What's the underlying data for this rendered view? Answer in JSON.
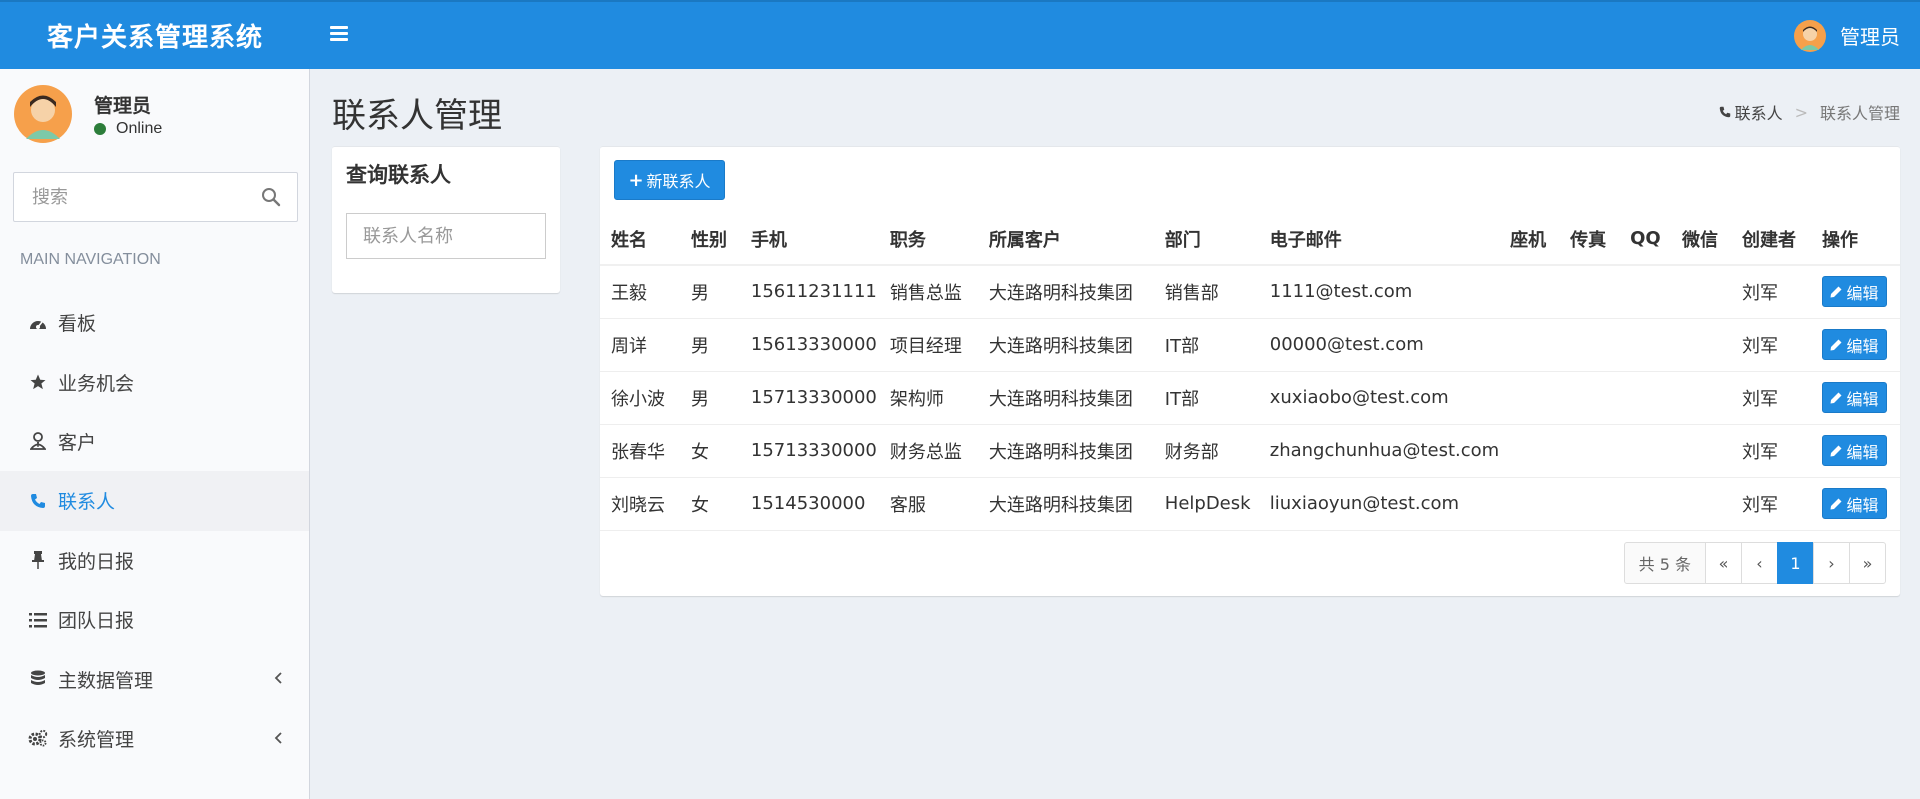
{
  "app": {
    "brand": "客户关系管理系统",
    "user": "管理员"
  },
  "sidebar": {
    "user_name": "管理员",
    "user_status": "Online",
    "search_placeholder": "搜索",
    "nav_header": "MAIN NAVIGATION",
    "items": [
      {
        "label": "看板",
        "icon": "dashboard-icon"
      },
      {
        "label": "业务机会",
        "icon": "star-icon"
      },
      {
        "label": "客户",
        "icon": "user-tie-icon"
      },
      {
        "label": "联系人",
        "icon": "phone-icon",
        "active": true
      },
      {
        "label": "我的日报",
        "icon": "pin-icon"
      },
      {
        "label": "团队日报",
        "icon": "list-icon"
      },
      {
        "label": "主数据管理",
        "icon": "database-icon",
        "expandable": true
      },
      {
        "label": "系统管理",
        "icon": "cogs-icon",
        "expandable": true
      }
    ]
  },
  "page": {
    "title": "联系人管理",
    "breadcrumb": [
      "联系人",
      "联系人管理"
    ],
    "breadcrumb_sep": ">"
  },
  "query": {
    "title": "查询联系人",
    "placeholder": "联系人名称"
  },
  "table": {
    "new_button": "新联系人",
    "columns": [
      "姓名",
      "性别",
      "手机",
      "职务",
      "所属客户",
      "部门",
      "电子邮件",
      "座机",
      "传真",
      "QQ",
      "微信",
      "创建者",
      "操作"
    ],
    "edit_label": "编辑",
    "rows": [
      [
        "王毅",
        "男",
        "15611231111",
        "销售总监",
        "大连路明科技集团",
        "销售部",
        "1111@test.com",
        "",
        "",
        "",
        "",
        "刘军"
      ],
      [
        "周详",
        "男",
        "15613330000",
        "项目经理",
        "大连路明科技集团",
        "IT部",
        "00000@test.com",
        "",
        "",
        "",
        "",
        "刘军"
      ],
      [
        "徐小波",
        "男",
        "15713330000",
        "架构师",
        "大连路明科技集团",
        "IT部",
        "xuxiaobo@test.com",
        "",
        "",
        "",
        "",
        "刘军"
      ],
      [
        "张春华",
        "女",
        "15713330000",
        "财务总监",
        "大连路明科技集团",
        "财务部",
        "zhangchunhua@test.com",
        "",
        "",
        "",
        "",
        "刘军"
      ],
      [
        "刘晓云",
        "女",
        "1514530000",
        "客服",
        "大连路明科技集团",
        "HelpDesk",
        "liuxiaoyun@test.com",
        "",
        "",
        "",
        "",
        "刘军"
      ]
    ]
  },
  "pager": {
    "total": "共 5 条",
    "first": "«",
    "prev": "‹",
    "current": "1",
    "next": "›",
    "last": "»"
  },
  "colors": {
    "primary": "#208be0",
    "header": "#208be0",
    "online": "#2c7d3a"
  }
}
